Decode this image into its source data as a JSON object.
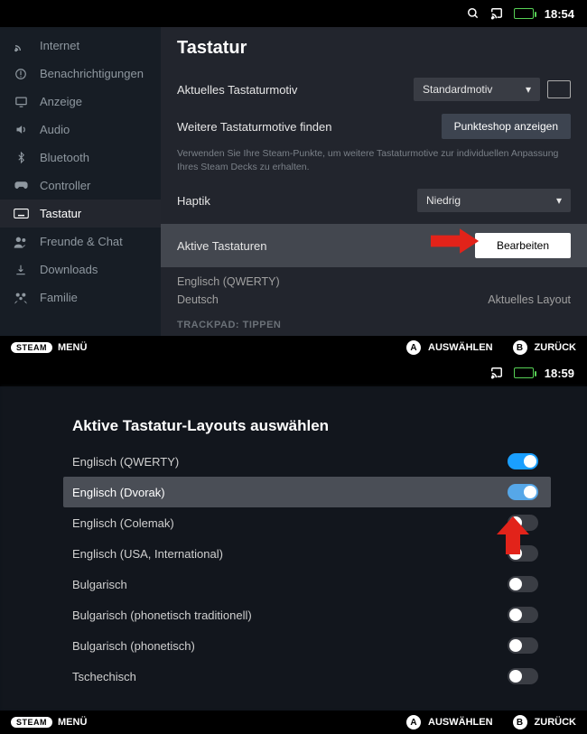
{
  "screen1": {
    "status": {
      "time": "18:54"
    },
    "sidebar": {
      "items": [
        {
          "icon": "wifi",
          "label": "Internet"
        },
        {
          "icon": "bell",
          "label": "Benachrichtigungen"
        },
        {
          "icon": "display",
          "label": "Anzeige"
        },
        {
          "icon": "audio",
          "label": "Audio"
        },
        {
          "icon": "bluetooth",
          "label": "Bluetooth"
        },
        {
          "icon": "controller",
          "label": "Controller"
        },
        {
          "icon": "keyboard",
          "label": "Tastatur"
        },
        {
          "icon": "friends",
          "label": "Freunde & Chat"
        },
        {
          "icon": "download",
          "label": "Downloads"
        },
        {
          "icon": "family",
          "label": "Familie"
        }
      ],
      "active_index": 6
    },
    "content": {
      "title": "Tastatur",
      "theme_label": "Aktuelles Tastaturmotiv",
      "theme_value": "Standardmotiv",
      "find_label": "Weitere Tastaturmotive finden",
      "shop_btn": "Punkteshop anzeigen",
      "hint": "Verwenden Sie Ihre Steam-Punkte, um weitere Tastaturmotive zur individuellen Anpassung Ihres Steam Decks zu erhalten.",
      "haptic_label": "Haptik",
      "haptic_value": "Niedrig",
      "active_kbd_label": "Aktive Tastaturen",
      "edit_btn": "Bearbeiten",
      "layouts": [
        {
          "name": "Englisch (QWERTY)",
          "note": ""
        },
        {
          "name": "Deutsch",
          "note": "Aktuelles Layout"
        }
      ],
      "trackpad": "TRACKPAD: TIPPEN"
    }
  },
  "screen2": {
    "status": {
      "time": "18:59"
    },
    "modal": {
      "title": "Aktive Tastatur-Layouts auswählen",
      "items": [
        {
          "label": "Englisch (QWERTY)",
          "on": true
        },
        {
          "label": "Englisch (Dvorak)",
          "on": true
        },
        {
          "label": "Englisch (Colemak)",
          "on": false
        },
        {
          "label": "Englisch (USA, International)",
          "on": false
        },
        {
          "label": "Bulgarisch",
          "on": false
        },
        {
          "label": "Bulgarisch (phonetisch traditionell)",
          "on": false
        },
        {
          "label": "Bulgarisch (phonetisch)",
          "on": false
        },
        {
          "label": "Tschechisch",
          "on": false
        }
      ],
      "highlight_index": 1
    }
  },
  "footer": {
    "steam": "STEAM",
    "menu": "MENÜ",
    "a_label": "AUSWÄHLEN",
    "b_label": "ZURÜCK",
    "a": "A",
    "b": "B"
  }
}
